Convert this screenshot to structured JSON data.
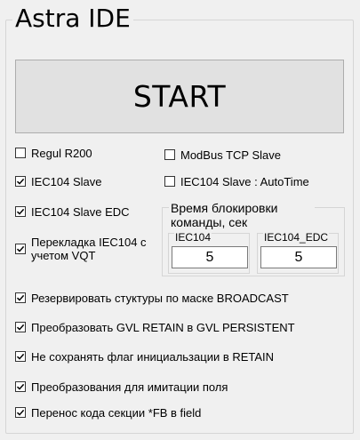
{
  "app": {
    "title": "Astra IDE"
  },
  "start_button": {
    "label": "START"
  },
  "options": [
    {
      "label": "Regul R200",
      "checked": false
    },
    {
      "label": "ModBus TCP Slave",
      "checked": false
    },
    {
      "label": "IEC104 Slave",
      "checked": true
    },
    {
      "label": "IEC104 Slave : AutoTime",
      "checked": false
    },
    {
      "label": "IEC104 Slave EDC",
      "checked": true
    },
    {
      "label": "Перекладка IEC104 с учетом VQT",
      "checked": true
    },
    {
      "label": "Резервировать стуктуры по маске BROADCAST",
      "checked": true
    },
    {
      "label": "Преобразовать GVL RETAIN в GVL PERSISTENT",
      "checked": true
    },
    {
      "label": "Не сохранять флаг инициальзации в RETAIN",
      "checked": true
    },
    {
      "label": "Преобразования для имитации поля",
      "checked": true
    },
    {
      "label": "Перенос кода секции *FB в field",
      "checked": true
    }
  ],
  "lock_time": {
    "title": "Время блокировки команды, сек",
    "iec104": {
      "label": "IEC104",
      "value": "5"
    },
    "iec104_edc": {
      "label": "IEC104_EDC",
      "value": "5"
    }
  }
}
